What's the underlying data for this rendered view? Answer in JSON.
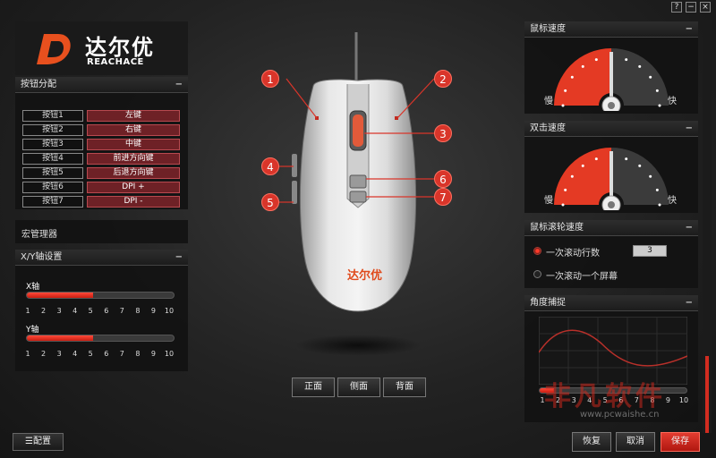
{
  "window": {
    "help": "?",
    "minimize": "−",
    "close": "×"
  },
  "brand": {
    "name_cn": "达尔优",
    "name_en": "REACHACE",
    "accent": "#e04a1c"
  },
  "button_assign": {
    "title": "按钮分配",
    "collapse": "−",
    "rows": [
      {
        "key": "按钮1",
        "value": "左键"
      },
      {
        "key": "按钮2",
        "value": "右键"
      },
      {
        "key": "按钮3",
        "value": "中键"
      },
      {
        "key": "按钮4",
        "value": "前进方向键"
      },
      {
        "key": "按钮5",
        "value": "后退方向键"
      },
      {
        "key": "按钮6",
        "value": "DPI +"
      },
      {
        "key": "按钮7",
        "value": "DPI -"
      }
    ]
  },
  "macro": {
    "label": "宏管理器"
  },
  "xy_axis": {
    "title": "X/Y轴设置",
    "collapse": "−",
    "x_label": "X轴",
    "y_label": "Y轴",
    "x_value": 5,
    "y_value": 5,
    "ticks": [
      "1",
      "2",
      "3",
      "4",
      "5",
      "6",
      "7",
      "8",
      "9",
      "10"
    ]
  },
  "config_button": "配置",
  "mouse": {
    "callouts": [
      "1",
      "2",
      "3",
      "4",
      "5",
      "6",
      "7"
    ],
    "views": [
      "正面",
      "侧面",
      "背面"
    ],
    "body_logo": "达尔优"
  },
  "pointer_speed": {
    "title": "鼠标速度",
    "collapse": "−",
    "slow": "慢",
    "fast": "快",
    "level": 0.5
  },
  "double_click": {
    "title": "双击速度",
    "collapse": "−",
    "slow": "慢",
    "fast": "快",
    "level": 0.5
  },
  "scroll_speed": {
    "title": "鼠标滚轮速度",
    "collapse": "−",
    "option_lines": "一次滚动行数",
    "option_screen": "一次滚动一个屏幕",
    "lines_value": "3",
    "selected": "option_lines"
  },
  "angle_snap": {
    "title": "角度捕捉",
    "collapse": "−",
    "ticks": [
      "1",
      "2",
      "3",
      "4",
      "5",
      "6",
      "7",
      "8",
      "9",
      "10"
    ],
    "level": 1
  },
  "footer": {
    "restore": "恢复",
    "cancel": "取消",
    "save": "保存"
  },
  "watermark": {
    "text": "非凡软件",
    "url": "www.pcwaishe.cn"
  }
}
